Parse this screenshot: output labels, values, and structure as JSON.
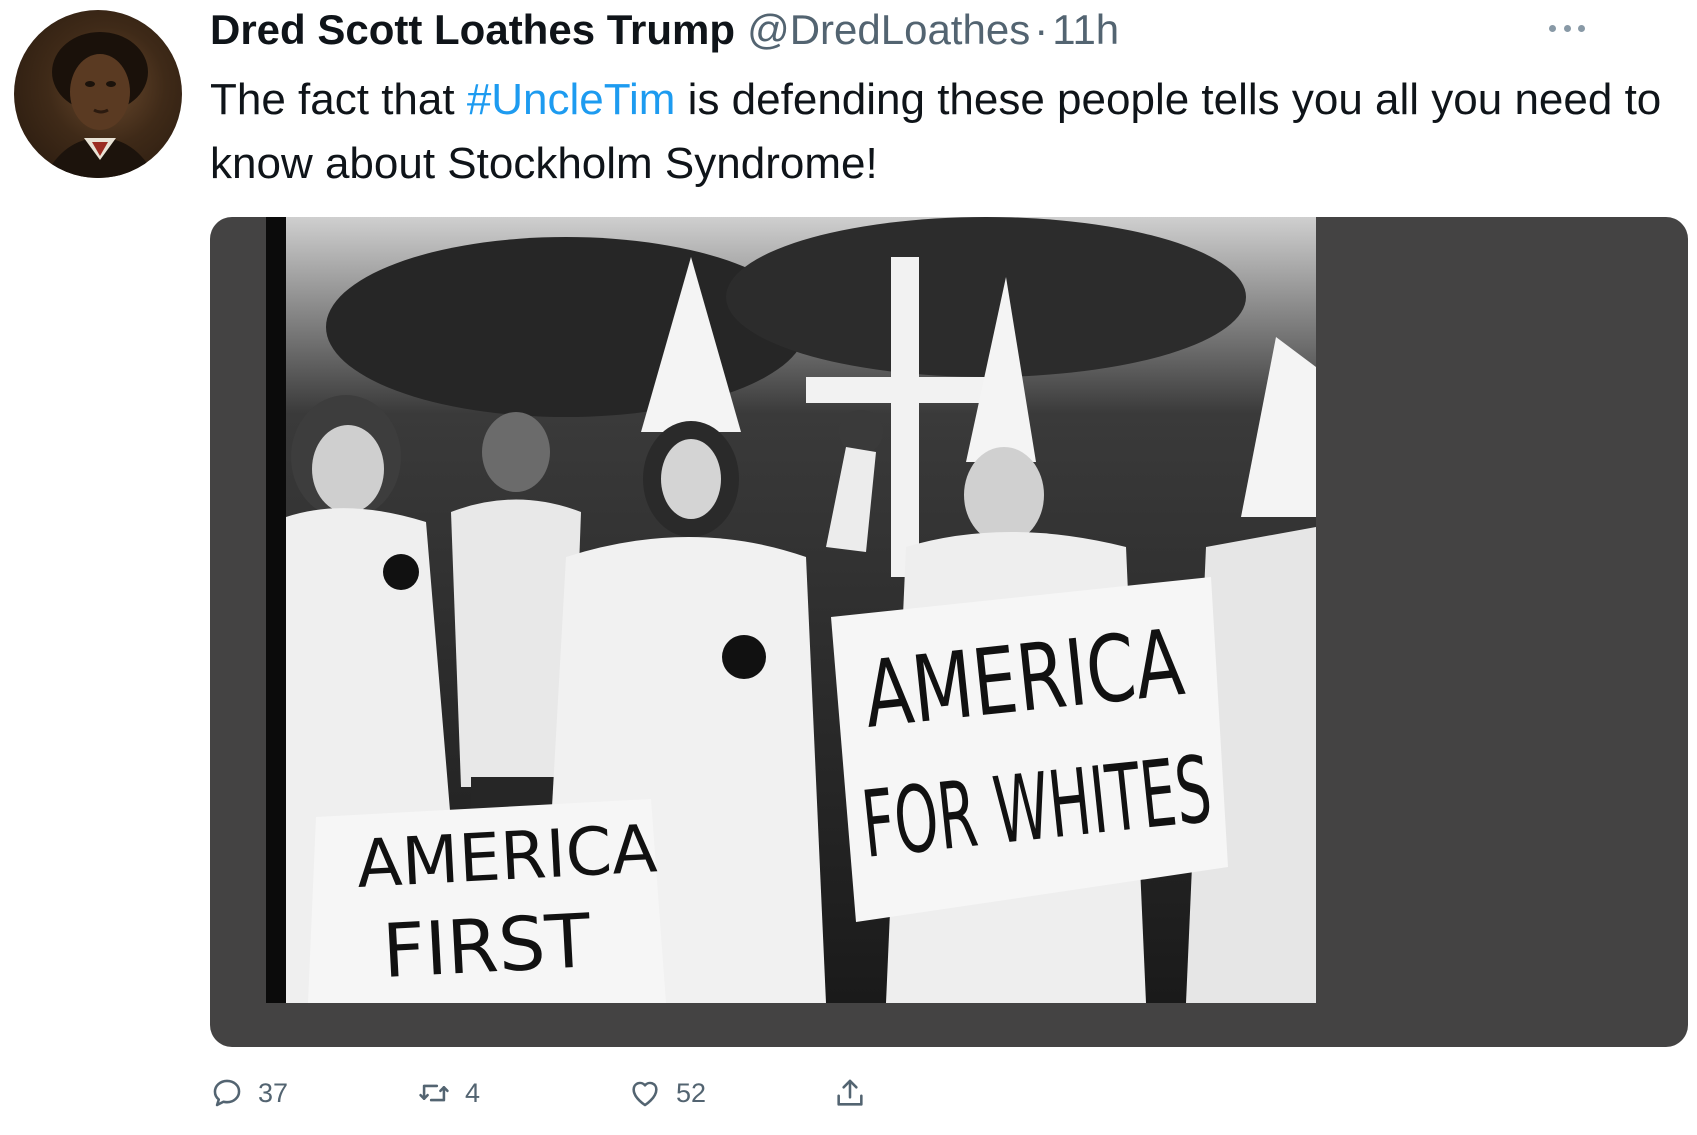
{
  "author": {
    "display_name": "Dred Scott Loathes Trump",
    "handle": "@DredLoathes",
    "separator": "·",
    "time": "11h"
  },
  "tweet": {
    "text_before": "The fact that ",
    "hashtag": "#UncleTim",
    "text_after": " is defending these people tells you all you need to know about Stockholm Syndrome!"
  },
  "media": {
    "signs": [
      {
        "line1": "AMERICA",
        "line2": "FIRST"
      },
      {
        "line1": "AMERICA",
        "line2": "FOR WHITES"
      }
    ]
  },
  "actions": {
    "replies": "37",
    "retweets": "4",
    "likes": "52"
  },
  "colors": {
    "hashtag": "#1d9bf0",
    "secondary_text": "#536471",
    "media_background": "#444343"
  },
  "icons": [
    "more-icon",
    "reply-icon",
    "retweet-icon",
    "like-icon",
    "share-icon"
  ]
}
